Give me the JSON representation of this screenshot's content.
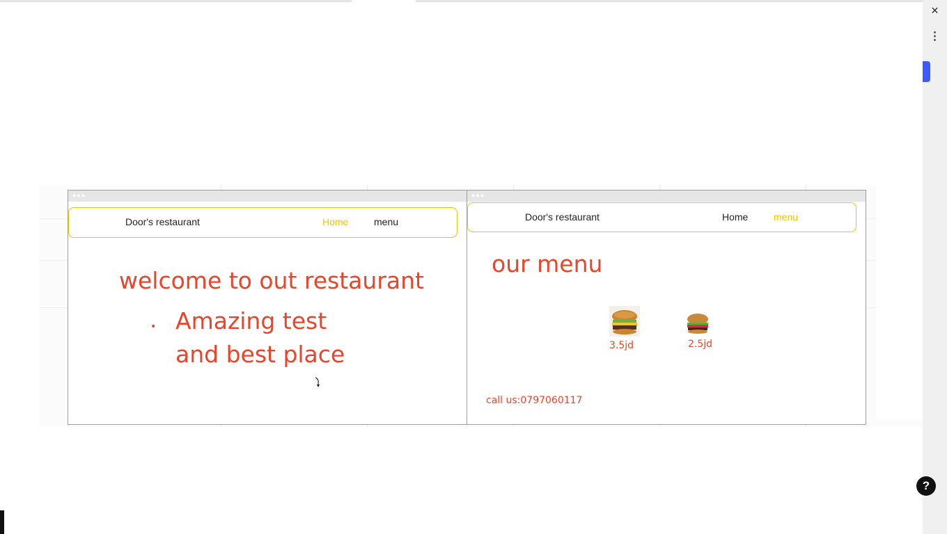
{
  "window": {
    "close_icon": "×",
    "more_icon": "⋮",
    "help_icon": "?"
  },
  "home_page": {
    "brand": "Door's restaurant",
    "nav": [
      {
        "label": "Home",
        "active": true
      },
      {
        "label": "menu",
        "active": false
      }
    ],
    "heading": "welcome to out restaurant",
    "bullet_symbol": "•",
    "bullet_line1": "Amazing test",
    "bullet_line2": "and best place"
  },
  "menu_page": {
    "brand": "Door's restaurant",
    "nav": [
      {
        "label": "Home",
        "active": false
      },
      {
        "label": "menu",
        "active": true
      }
    ],
    "heading": "our menu",
    "items": [
      {
        "image": "burger-image",
        "price": "3.5jd"
      },
      {
        "image": "burger-image",
        "price": "2.5jd"
      }
    ],
    "contact": "call us:0797060117"
  },
  "colors": {
    "accent_text": "#e9452a",
    "nav_border": "#f3c300",
    "active_link": "#f5c400"
  }
}
